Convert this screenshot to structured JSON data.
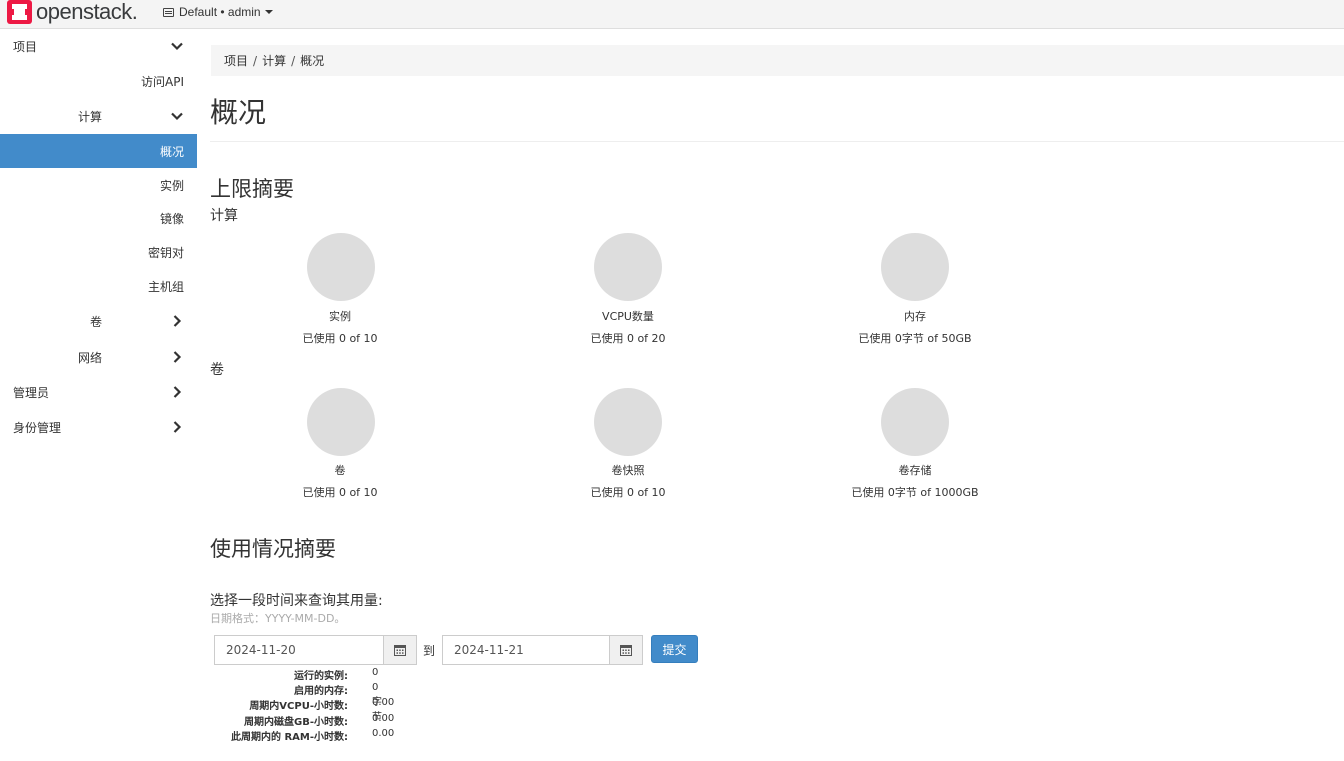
{
  "topbar": {
    "logo_text": "openstack.",
    "project_switch": "Default • admin"
  },
  "sidebar": {
    "items": [
      {
        "label": "项目",
        "expanded": true
      },
      {
        "label": "访问API"
      },
      {
        "label": "计算",
        "expanded": true
      },
      {
        "label": "概况",
        "active": true
      },
      {
        "label": "实例"
      },
      {
        "label": "镜像"
      },
      {
        "label": "密钥对"
      },
      {
        "label": "主机组"
      },
      {
        "label": "卷",
        "expanded": false
      },
      {
        "label": "网络",
        "expanded": false
      },
      {
        "label": "管理员",
        "expanded": false
      },
      {
        "label": "身份管理",
        "expanded": false
      }
    ]
  },
  "breadcrumb": [
    "项目",
    "计算",
    "概况"
  ],
  "page_title": "概况",
  "limits": {
    "title": "上限摘要",
    "compute": {
      "title": "计算",
      "charts": [
        {
          "name": "实例",
          "usage": "已使用 0 of 10",
          "used": 0,
          "limit": 10
        },
        {
          "name": "VCPU数量",
          "usage": "已使用 0 of 20",
          "used": 0,
          "limit": 20
        },
        {
          "name": "内存",
          "usage": "已使用 0字节 of 50GB",
          "used": 0,
          "limit": 50
        }
      ]
    },
    "volume": {
      "title": "卷",
      "charts": [
        {
          "name": "卷",
          "usage": "已使用 0 of 10",
          "used": 0,
          "limit": 10
        },
        {
          "name": "卷快照",
          "usage": "已使用 0 of 10",
          "used": 0,
          "limit": 10
        },
        {
          "name": "卷存储",
          "usage": "已使用 0字节 of 1000GB",
          "used": 0,
          "limit": 1000
        }
      ]
    }
  },
  "usage": {
    "title": "使用情况摘要",
    "query_label": "选择一段时间来查询其用量:",
    "date_hint": "日期格式：YYYY-MM-DD。",
    "start_date": "2024-11-20",
    "to_label": "到",
    "end_date": "2024-11-21",
    "submit_label": "提交",
    "stats": [
      {
        "key": "运行的实例:",
        "value": "0"
      },
      {
        "key": "启用的内存:",
        "value": "0字节"
      },
      {
        "key": "周期内VCPU-小时数:",
        "value": "0.00"
      },
      {
        "key": "周期内磁盘GB-小时数:",
        "value": "0.00"
      },
      {
        "key": "此周期内的 RAM-小时数:",
        "value": "0.00"
      }
    ]
  },
  "colors": {
    "accent": "#428bca",
    "pie_empty": "#dddddd",
    "logo_red": "#ed1944"
  }
}
